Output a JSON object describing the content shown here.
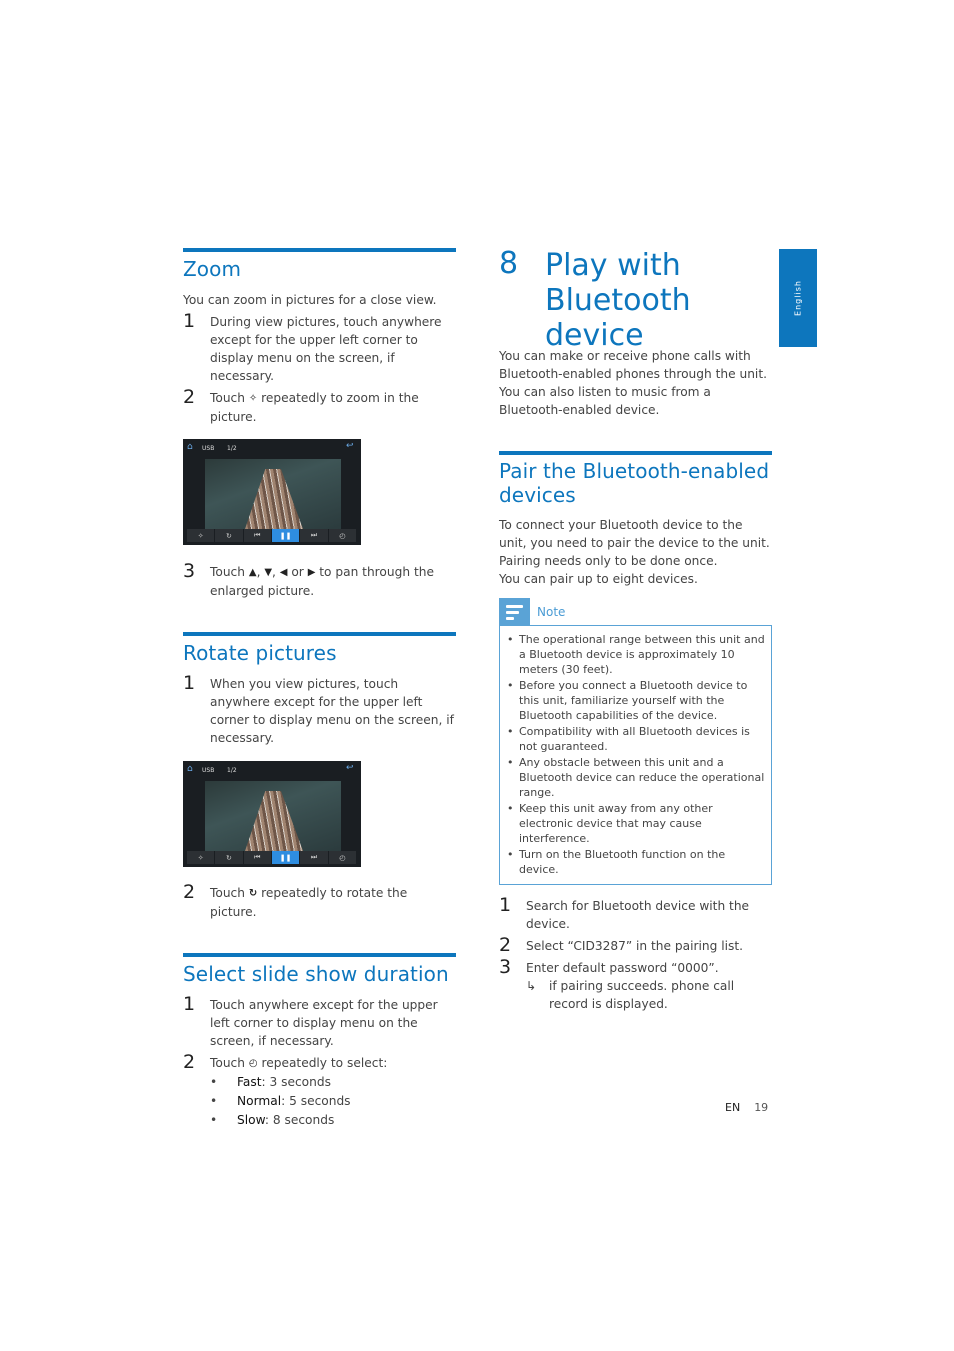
{
  "side_tab": {
    "label": "English"
  },
  "zoom": {
    "heading": "Zoom",
    "intro": "You can zoom in pictures for a close view.",
    "steps": [
      {
        "num": "1",
        "text": "During view pictures, touch anywhere except for the upper left corner to display menu on the screen, if necessary."
      },
      {
        "num": "2",
        "before": "Touch",
        "icon": "zoom-icon",
        "after": "repeatedly to zoom in the picture."
      },
      {
        "num": "3",
        "before": "Touch",
        "icons": [
          "up-arrow-icon",
          "down-arrow-icon",
          "left-arrow-icon",
          "right-arrow-icon"
        ],
        "after": "to pan through the enlarged picture."
      }
    ]
  },
  "screen": {
    "source": "USB",
    "counter": "1/2",
    "controls": [
      "zoom-icon",
      "rotate-icon",
      "previous-icon",
      "pause-icon",
      "next-icon",
      "timer-icon"
    ]
  },
  "rotate": {
    "heading": "Rotate pictures",
    "steps": [
      {
        "num": "1",
        "text": "When you view pictures, touch anywhere except for the upper left corner to display menu on the screen, if necessary."
      },
      {
        "num": "2",
        "before": "Touch",
        "icon": "rotate-icon",
        "after": "repeatedly to rotate the picture."
      }
    ]
  },
  "slideshow": {
    "heading": "Select slide show duration",
    "steps": [
      {
        "num": "1",
        "text": "Touch anywhere except for the upper left corner to display menu on the screen, if necessary."
      },
      {
        "num": "2",
        "before": "Touch",
        "icon": "timer-icon",
        "after": "repeatedly to select:"
      }
    ],
    "options": [
      {
        "name": "Fast",
        "value": ": 3 seconds"
      },
      {
        "name": "Normal",
        "value": ": 5 seconds"
      },
      {
        "name": "Slow",
        "value": ": 8 seconds"
      }
    ]
  },
  "chapter": {
    "number": "8",
    "title": "Play with Bluetooth device",
    "intro": "You can make or receive phone calls with Bluetooth-enabled phones through the unit. You can also listen to music from a Bluetooth-enabled device."
  },
  "pair": {
    "heading": "Pair the Bluetooth-enabled devices",
    "intro1": "To connect your Bluetooth device to the unit, you need to pair the device to the unit. Pairing needs only to be done once.",
    "intro2": "You can pair up to eight devices.",
    "note_label": "Note",
    "notes": [
      "The operational range between this unit and a Bluetooth device is approximately 10 meters (30 feet).",
      "Before you connect a Bluetooth device to this unit, familiarize yourself with the Bluetooth capabilities of the device.",
      "Compatibility with all Bluetooth devices is not guaranteed.",
      "Any obstacle between this unit and a Bluetooth device can reduce the operational range.",
      "Keep this unit away from any other electronic device that may cause interference.",
      "Turn on the Bluetooth function on the device."
    ],
    "steps": [
      {
        "num": "1",
        "text": "Search for Bluetooth device with the device."
      },
      {
        "num": "2",
        "text": "Select “CID3287” in the pairing list."
      },
      {
        "num": "3",
        "text": "Enter default password “0000”."
      }
    ],
    "result": "if pairing succeeds. phone call record is displayed."
  },
  "footer": {
    "lang": "EN",
    "page": "19"
  },
  "colors": {
    "accent": "#0d76bd",
    "note": "#5aa3d6"
  }
}
